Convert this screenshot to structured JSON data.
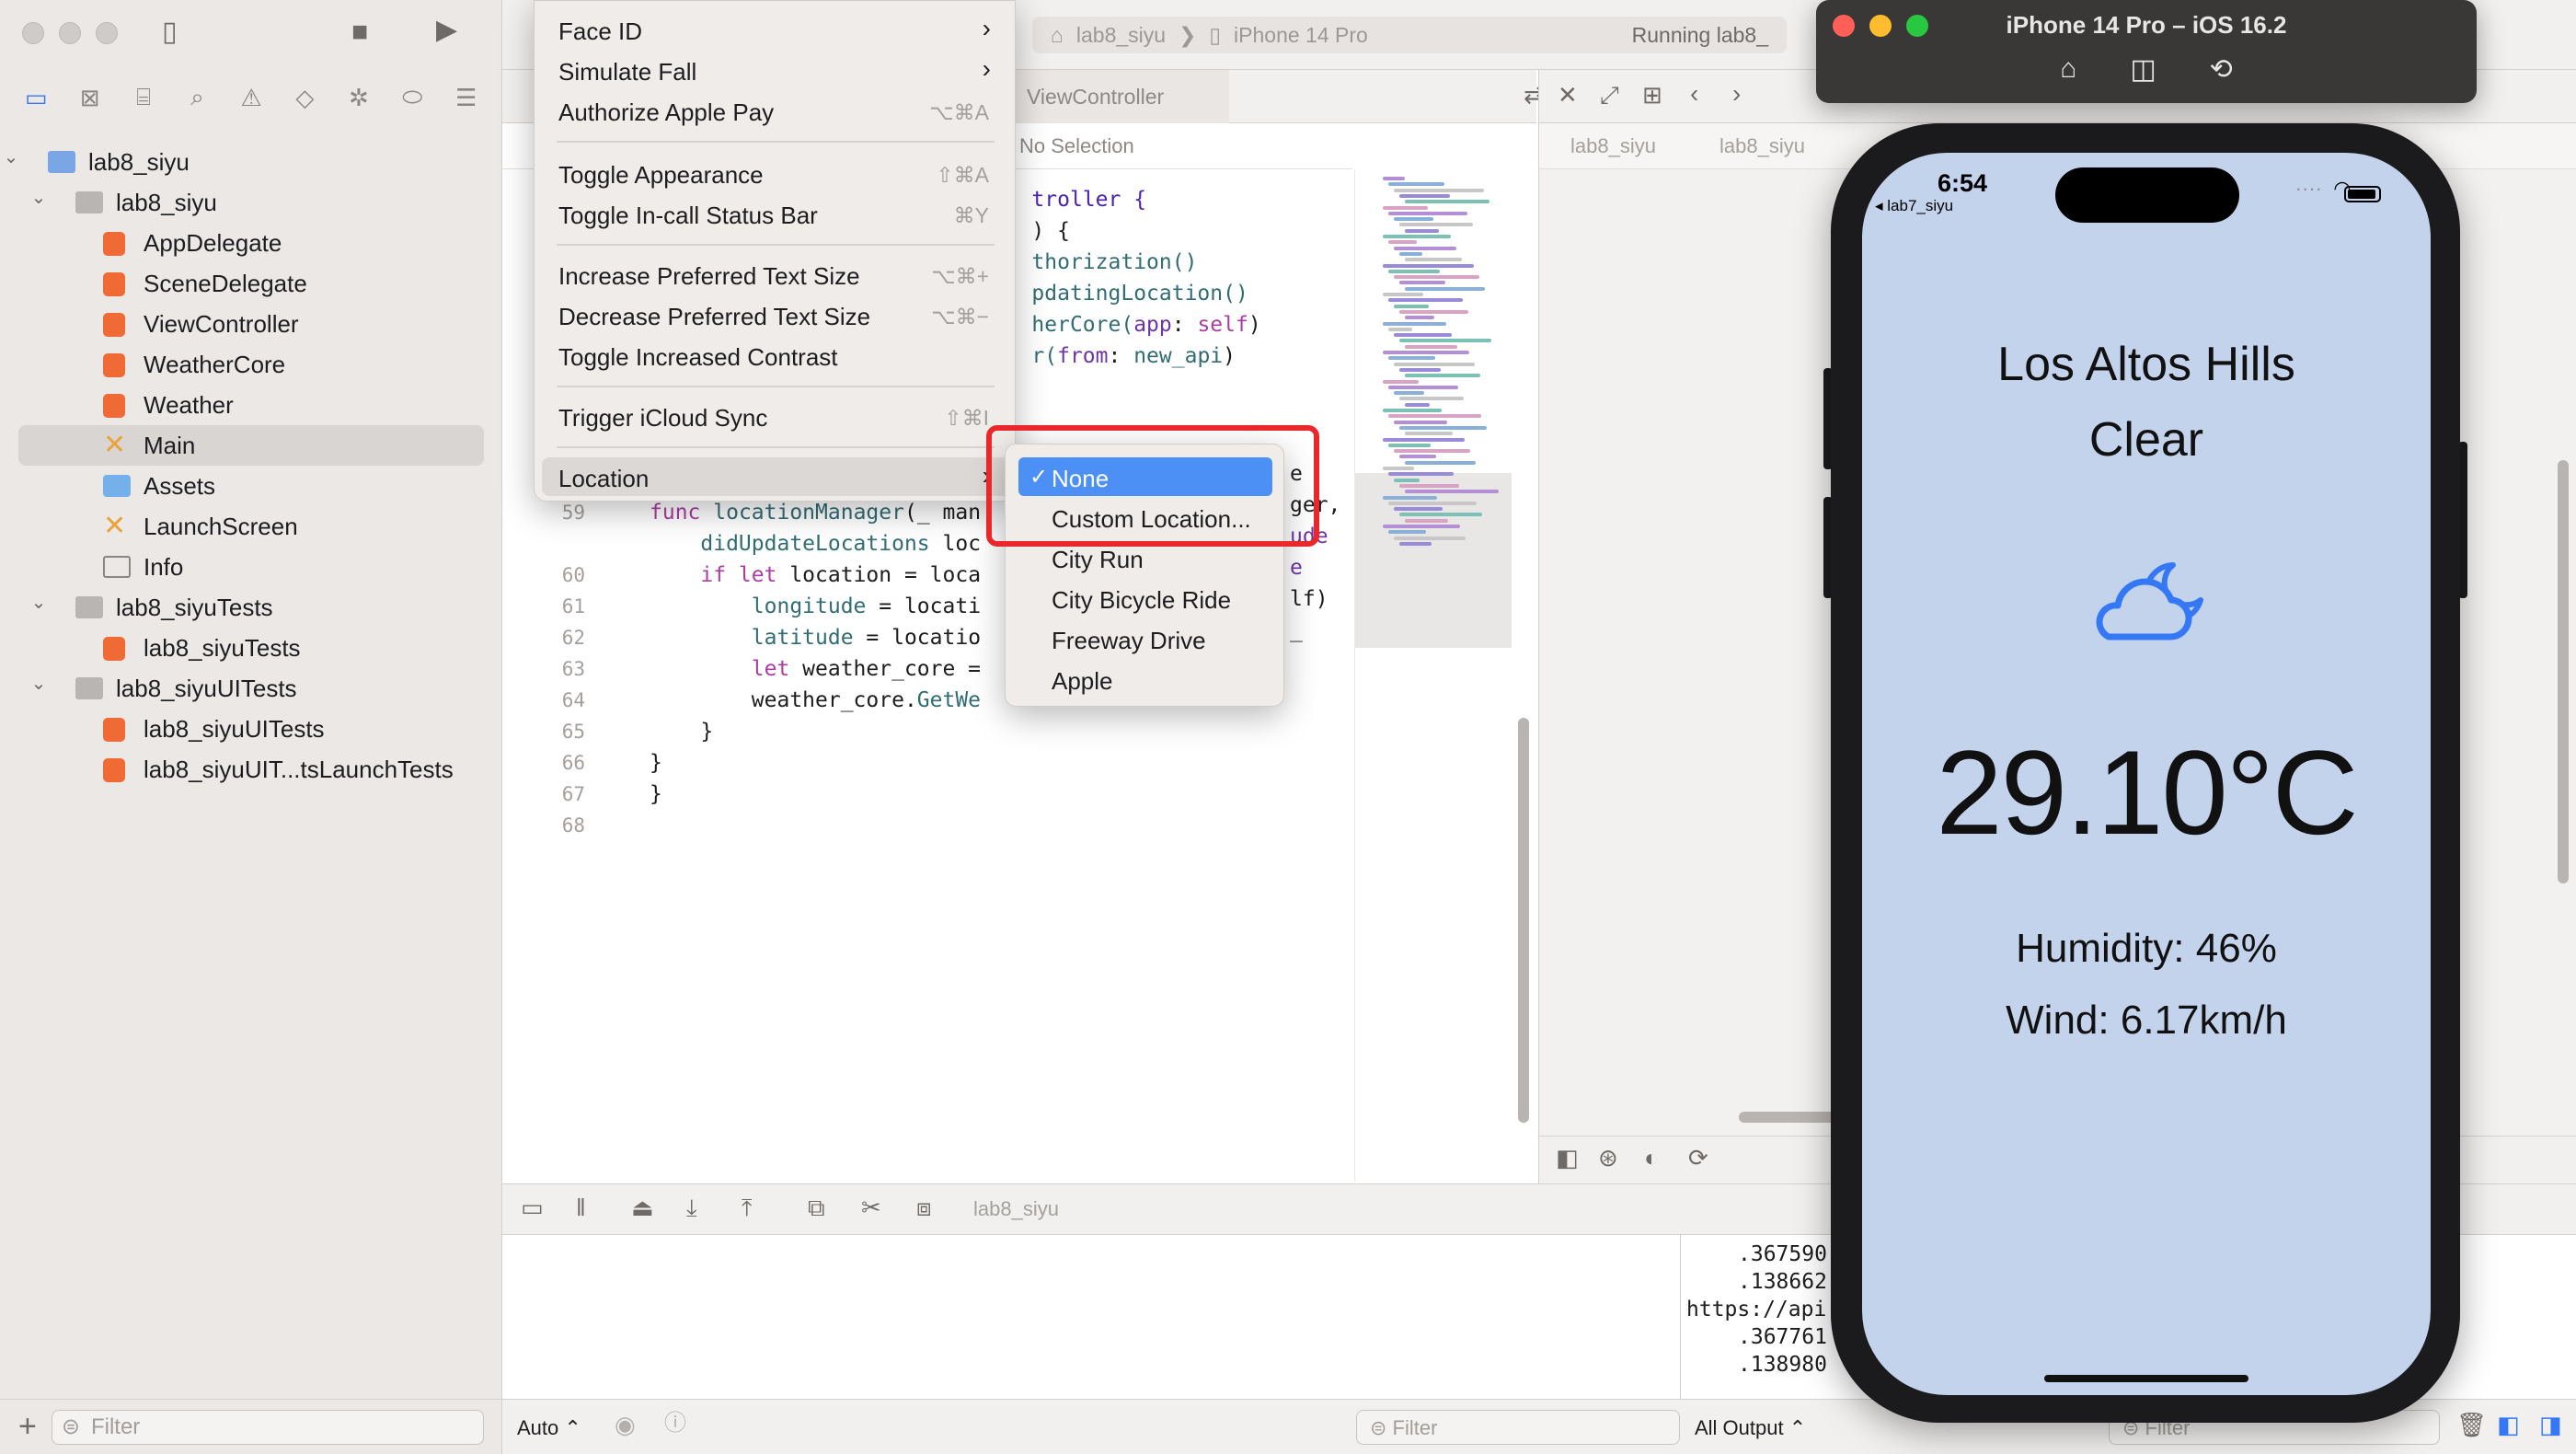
{
  "project_nav": {
    "items": [
      {
        "label": "lab8_siyu",
        "depth": 0,
        "kind": "project",
        "expanded": true
      },
      {
        "label": "lab8_siyu",
        "depth": 1,
        "kind": "folder",
        "expanded": true
      },
      {
        "label": "AppDelegate",
        "depth": 2,
        "kind": "swift"
      },
      {
        "label": "SceneDelegate",
        "depth": 2,
        "kind": "swift"
      },
      {
        "label": "ViewController",
        "depth": 2,
        "kind": "swift"
      },
      {
        "label": "WeatherCore",
        "depth": 2,
        "kind": "swift"
      },
      {
        "label": "Weather",
        "depth": 2,
        "kind": "swift"
      },
      {
        "label": "Main",
        "depth": 2,
        "kind": "storyboard",
        "selected": true
      },
      {
        "label": "Assets",
        "depth": 2,
        "kind": "assets"
      },
      {
        "label": "LaunchScreen",
        "depth": 2,
        "kind": "storyboard"
      },
      {
        "label": "Info",
        "depth": 2,
        "kind": "plist"
      },
      {
        "label": "lab8_siyuTests",
        "depth": 1,
        "kind": "folder",
        "expanded": true
      },
      {
        "label": "lab8_siyuTests",
        "depth": 2,
        "kind": "swift"
      },
      {
        "label": "lab8_siyuUITests",
        "depth": 1,
        "kind": "folder",
        "expanded": true
      },
      {
        "label": "lab8_siyuUITests",
        "depth": 2,
        "kind": "swift"
      },
      {
        "label": "lab8_siyuUIT...tsLaunchTests",
        "depth": 2,
        "kind": "swift"
      }
    ],
    "filter_placeholder": "Filter"
  },
  "toolbar": {
    "scheme": "lab8_siyu",
    "device": "iPhone 14 Pro",
    "status": "Running lab8_"
  },
  "editor": {
    "tab_label": "ViewController",
    "jump_bar": "No Selection",
    "lines": [
      {
        "num": "",
        "segments": [
          {
            "t": "                              troller {",
            "c": "ty"
          }
        ]
      },
      {
        "num": "",
        "segments": [
          {
            "t": "                              ) {",
            "c": ""
          }
        ]
      },
      {
        "num": "",
        "segments": [
          {
            "t": "                              thorization()",
            "c": "fn"
          }
        ]
      },
      {
        "num": "",
        "segments": [
          {
            "t": "                              pdatingLocation()",
            "c": "fn"
          }
        ]
      },
      {
        "num": "",
        "segments": [
          {
            "t": "                              herCore(",
            "c": "fn"
          },
          {
            "t": "app",
            "c": "pr"
          },
          {
            "t": ": ",
            "c": ""
          },
          {
            "t": "self",
            "c": "kw"
          },
          {
            "t": ")",
            "c": ""
          }
        ]
      },
      {
        "num": "",
        "segments": [
          {
            "t": "                              r(",
            "c": "fn"
          },
          {
            "t": "from",
            "c": "pr"
          },
          {
            "t": ": ",
            "c": ""
          },
          {
            "t": "new_api",
            "c": "fn"
          },
          {
            "t": ")",
            "c": ""
          }
        ]
      },
      {
        "num": "59",
        "segments": [
          {
            "t": "func ",
            "c": "kw"
          },
          {
            "t": "locationManager",
            "c": "fn"
          },
          {
            "t": "(_ ",
            "c": ""
          },
          {
            "t": "man",
            "c": ""
          }
        ]
      },
      {
        "num": "",
        "segments": [
          {
            "t": "    didUpdateLocations ",
            "c": "fn"
          },
          {
            "t": "loc",
            "c": ""
          }
        ]
      },
      {
        "num": "60",
        "segments": [
          {
            "t": "    if let ",
            "c": "kw"
          },
          {
            "t": "location = ",
            "c": ""
          },
          {
            "t": "loca",
            "c": ""
          }
        ]
      },
      {
        "num": "61",
        "segments": [
          {
            "t": "        longitude",
            "c": "fn"
          },
          {
            "t": " = ",
            "c": ""
          },
          {
            "t": "locati",
            "c": ""
          }
        ]
      },
      {
        "num": "62",
        "segments": [
          {
            "t": "        latitude",
            "c": "fn"
          },
          {
            "t": " = ",
            "c": ""
          },
          {
            "t": "locatio",
            "c": ""
          }
        ]
      },
      {
        "num": "63",
        "segments": [
          {
            "t": "        let ",
            "c": "kw"
          },
          {
            "t": "weather_core = ",
            "c": ""
          }
        ]
      },
      {
        "num": "64",
        "segments": [
          {
            "t": "        weather_core.",
            "c": ""
          },
          {
            "t": "GetWe",
            "c": "fn"
          }
        ]
      },
      {
        "num": "65",
        "segments": [
          {
            "t": "    }",
            "c": ""
          }
        ]
      },
      {
        "num": "66",
        "segments": [
          {
            "t": "}",
            "c": ""
          }
        ]
      },
      {
        "num": "67",
        "segments": [
          {
            "t": "}",
            "c": ""
          }
        ]
      },
      {
        "num": "68",
        "segments": [
          {
            "t": "",
            "c": ""
          }
        ]
      }
    ],
    "right_fragments": [
      "e",
      "ger,",
      "ude",
      "e",
      "lf)",
      "_"
    ]
  },
  "canvas": {
    "jump_1": "lab8_siyu",
    "jump_2": "lab8_siyu"
  },
  "debug": {
    "project": "lab8_siyu",
    "auto_label": "Auto ⌃",
    "filter_placeholder": "Filter",
    "output_label": "All Output ⌃",
    "console_lines": [
      ".367590",
      ".138662",
      "https://api",
      ".367761",
      ".138980"
    ]
  },
  "simulator": {
    "title": "iPhone 14 Pro – iOS 16.2",
    "status_time": "6:54",
    "back_label": "◂ lab7_siyu",
    "city": "Los Altos Hills",
    "condition": "Clear",
    "temperature": "29.10°C",
    "humidity": "Humidity: 46%",
    "wind": "Wind: 6.17km/h",
    "icon": "cloud-moon-icon",
    "accent_color": "#3478f6",
    "screen_bg": "#c4d3ec"
  },
  "menu": {
    "items": [
      {
        "label": "Face ID",
        "shortcut": "",
        "submenu": true
      },
      {
        "label": "Simulate Fall",
        "shortcut": "",
        "submenu": true
      },
      {
        "label": "Authorize Apple Pay",
        "shortcut": "⌥⌘A",
        "submenu": false
      },
      {
        "sep": true
      },
      {
        "label": "Toggle Appearance",
        "shortcut": "⇧⌘A",
        "submenu": false
      },
      {
        "label": "Toggle In-call Status Bar",
        "shortcut": "⌘Y",
        "submenu": false
      },
      {
        "sep": true
      },
      {
        "label": "Increase Preferred Text Size",
        "shortcut": "⌥⌘+",
        "submenu": false
      },
      {
        "label": "Decrease Preferred Text Size",
        "shortcut": "⌥⌘−",
        "submenu": false
      },
      {
        "label": "Toggle Increased Contrast",
        "shortcut": "",
        "submenu": false
      },
      {
        "sep": true
      },
      {
        "label": "Trigger iCloud Sync",
        "shortcut": "⇧⌘I",
        "submenu": false
      },
      {
        "sep": true
      },
      {
        "label": "Location",
        "shortcut": "",
        "submenu": true,
        "highlighted": true
      }
    ],
    "location_submenu": [
      {
        "label": "None",
        "checked": true,
        "selected": true
      },
      {
        "label": "Custom Location...",
        "checked": false
      },
      {
        "label": "City Run",
        "checked": false
      },
      {
        "label": "City Bicycle Ride",
        "checked": false
      },
      {
        "label": "Freeway Drive",
        "checked": false
      },
      {
        "label": "Apple",
        "checked": false
      }
    ],
    "check_glyph": "✓",
    "annotation_color": "#e8282b"
  }
}
